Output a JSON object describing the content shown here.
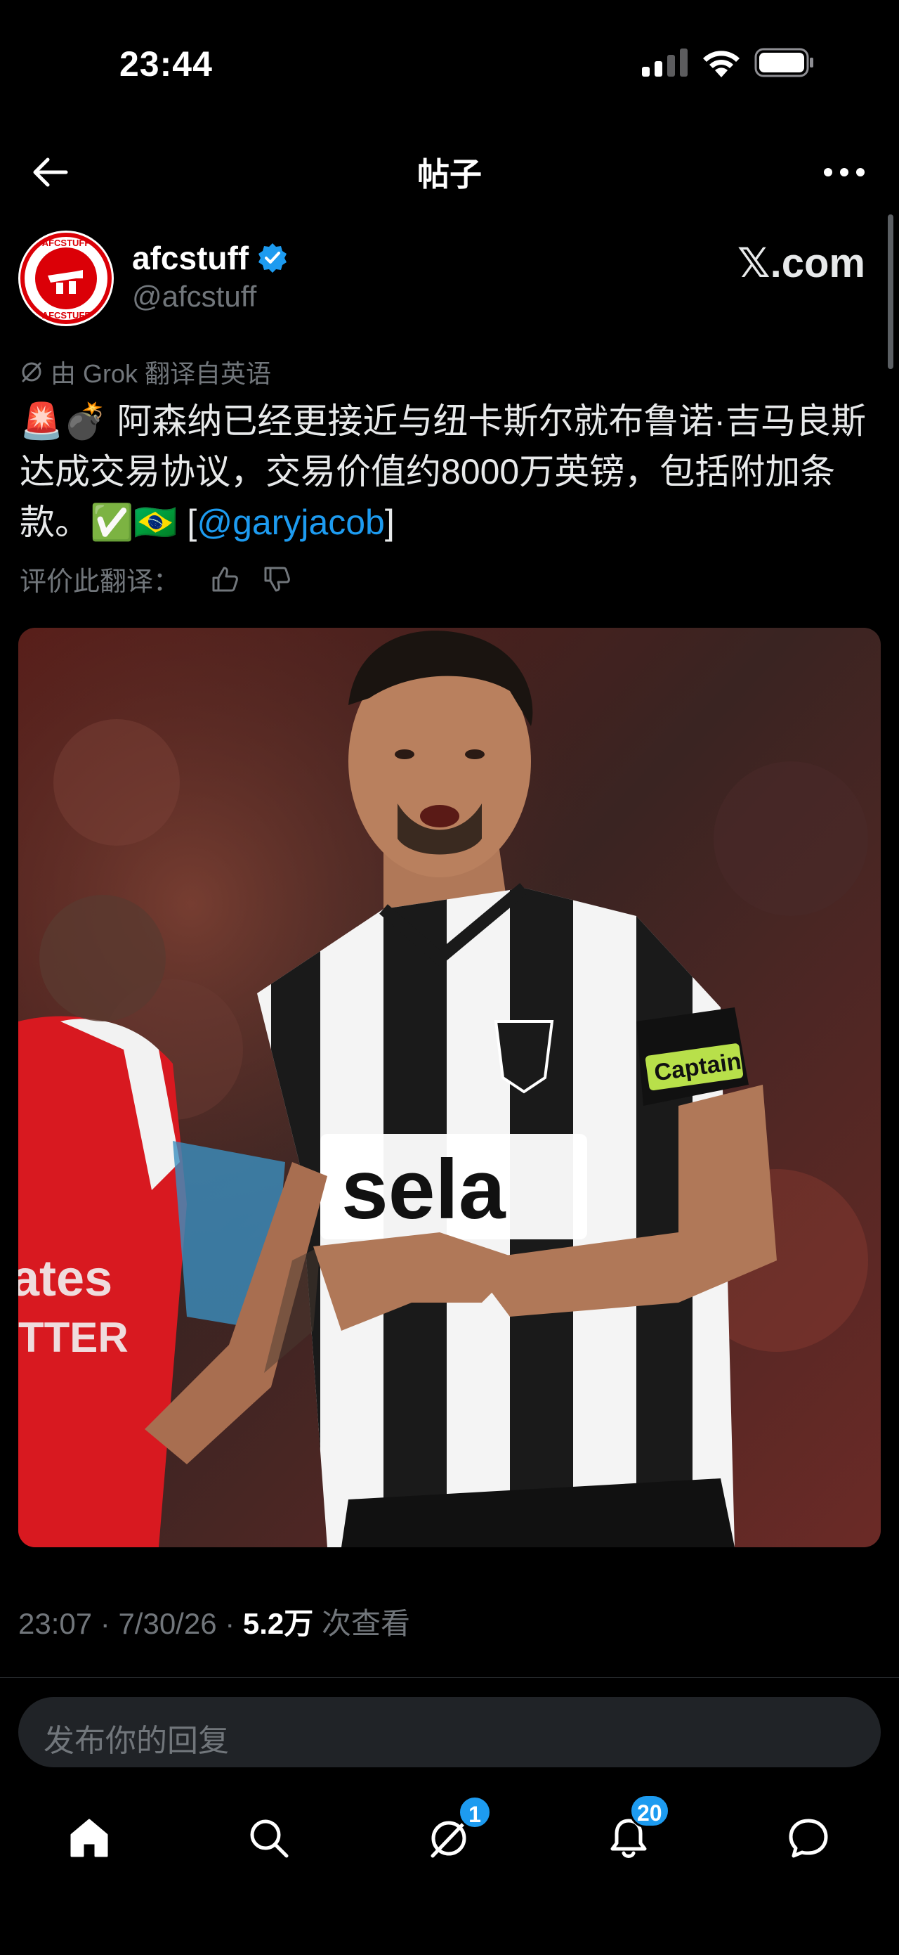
{
  "status_bar": {
    "time": "23:44"
  },
  "nav": {
    "title": "帖子"
  },
  "author": {
    "name": "afcstuff",
    "handle": "@afcstuff",
    "avatar_text_top": "AFCSTUFF",
    "avatar_text_bottom": "AFCSTUFF",
    "verified_color": "#1d9bf0"
  },
  "watermark": "𝕏.com",
  "translation": {
    "label": "由 Grok 翻译自英语",
    "emoji_prefix": "🚨💣",
    "text": " 阿森纳已经更接近与纽卡斯尔就布鲁诺·吉马良斯达成交易协议，交易价值约8000万英镑，包括附加条款。",
    "emoji_suffix": "✅🇧🇷",
    "mention_open": " [",
    "mention": "@garyjacob",
    "mention_close": "]",
    "rate_label": "评价此翻译："
  },
  "media": {
    "sponsor_text": "sela",
    "armband_text": "Captain",
    "icon": "player-photo"
  },
  "meta": {
    "time": "23:07",
    "date": "7/30/26",
    "views": "5.2万",
    "views_label": "次查看",
    "sep": " · "
  },
  "reply": {
    "placeholder": "发布你的回复"
  },
  "bottom_nav": {
    "messages_badge": "1",
    "notifications_badge": "20"
  },
  "colors": {
    "accent": "#1d9bf0",
    "background": "#000000",
    "muted": "#71767b"
  }
}
